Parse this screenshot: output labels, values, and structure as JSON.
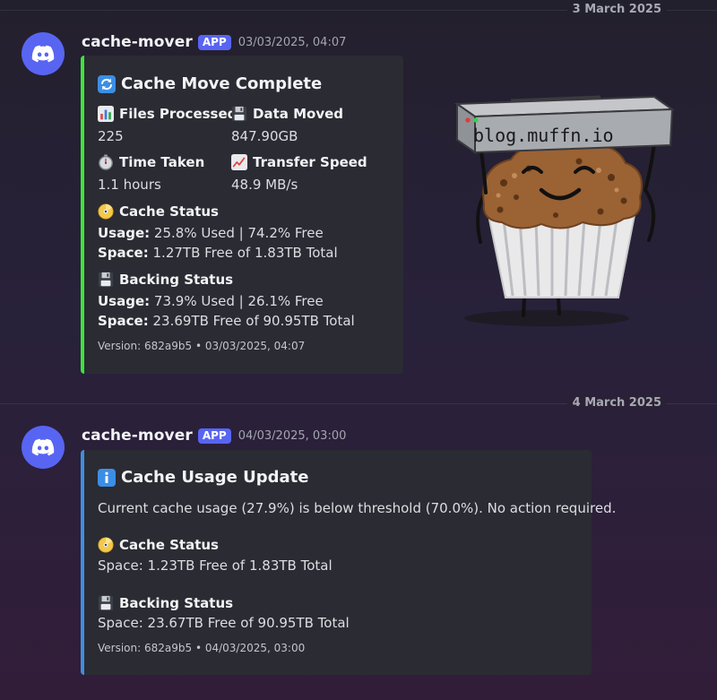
{
  "dates": [
    "3 March 2025",
    "4 March 2025"
  ],
  "messages": [
    {
      "author": "cache-mover",
      "tag": "APP",
      "timestamp": "03/03/2025, 04:07",
      "embed": {
        "accent_color": "#3be53b",
        "title": "Cache Move Complete",
        "title_icon": "refresh-icon",
        "fields": [
          {
            "name": "Files Processed",
            "icon": "bar-chart-icon",
            "value": "225"
          },
          {
            "name": "Data Moved",
            "icon": "floppy-disk-icon",
            "value": "847.90GB"
          },
          {
            "name": "Time Taken",
            "icon": "stopwatch-icon",
            "value": "1.1 hours"
          },
          {
            "name": "Transfer Speed",
            "icon": "chart-increasing-icon",
            "value": "48.9 MB/s"
          }
        ],
        "cache_status": {
          "name": "Cache Status",
          "icon": "dvd-icon",
          "usage_label": "Usage:",
          "usage_value": "25.8% Used | 74.2% Free",
          "space_label": "Space:",
          "space_value": "1.27TB Free of 1.83TB Total"
        },
        "backing_status": {
          "name": "Backing Status",
          "icon": "floppy-disk-icon",
          "usage_label": "Usage:",
          "usage_value": "73.9% Used | 26.1% Free",
          "space_label": "Space:",
          "space_value": "23.69TB Free of 90.95TB Total"
        },
        "footer": "Version: 682a9b5 • 03/03/2025, 04:07",
        "thumbnail": {
          "text": "blog.muffn.io",
          "icon": "muffin-mascot-icon"
        }
      }
    },
    {
      "author": "cache-mover",
      "tag": "APP",
      "timestamp": "04/03/2025, 03:00",
      "embed": {
        "accent_color": "#3d8fe0",
        "title": "Cache Usage Update",
        "title_icon": "info-icon",
        "description": "Current cache usage (27.9%) is below threshold (70.0%). No action required.",
        "cache_status": {
          "name": "Cache Status",
          "icon": "dvd-icon",
          "value": "Space: 1.23TB Free of 1.83TB Total"
        },
        "backing_status": {
          "name": "Backing Status",
          "icon": "floppy-disk-icon",
          "value": "Space: 23.67TB Free of 90.95TB Total"
        },
        "footer": "Version: 682a9b5 • 04/03/2025, 03:00"
      }
    }
  ]
}
